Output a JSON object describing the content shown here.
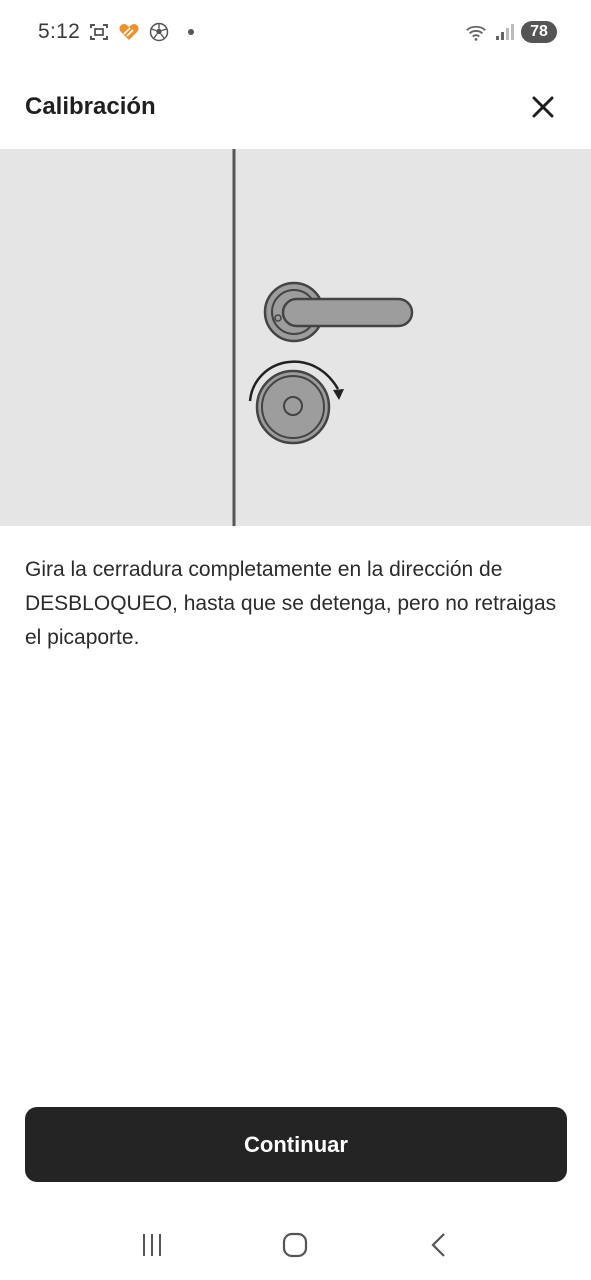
{
  "status_bar": {
    "time": "5:12",
    "battery": "78",
    "icons": [
      "screenshot-icon",
      "heart-icon",
      "soccer-ball-icon",
      "notification-dot",
      "wifi-icon",
      "signal-icon",
      "battery-icon"
    ]
  },
  "header": {
    "title": "Calibración",
    "close_icon": "close-icon"
  },
  "illustration": {
    "description_icon": "door-lock-rotate-illustration",
    "background_color": "#e5e5e5"
  },
  "instruction": {
    "text": "Gira la cerradura completamente en la dirección de DESBLOQUEO, hasta que se detenga, pero no retraigas el picaporte."
  },
  "continue_button": {
    "label": "Continuar",
    "color": "#242424"
  },
  "nav_bar": {
    "recents_icon": "recents-icon",
    "home_icon": "home-icon",
    "back_icon": "back-icon"
  }
}
